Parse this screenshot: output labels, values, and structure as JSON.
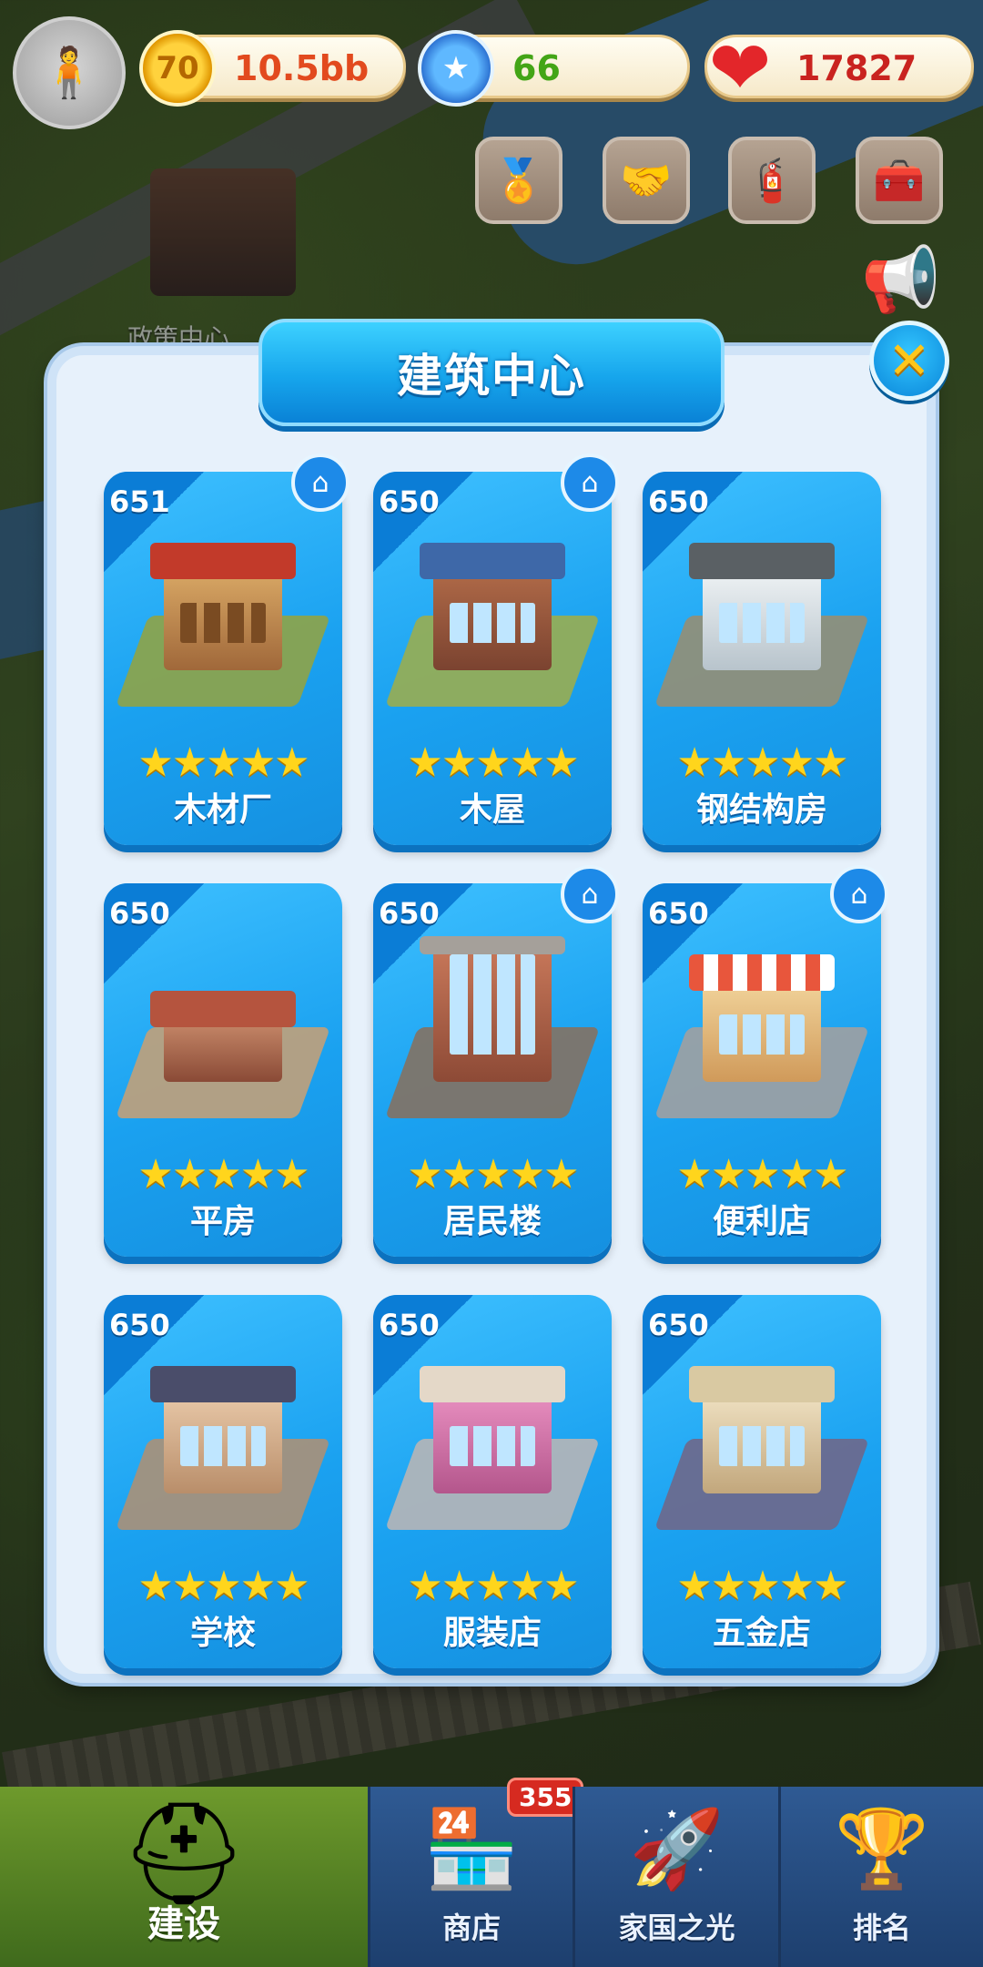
{
  "hud": {
    "coins": "10.5bb",
    "stars": "66",
    "hearts": "17827",
    "coin_icon_text": "70",
    "coin_icon": "coin-icon",
    "star_icon": "star-icon",
    "heart_icon": "heart-icon"
  },
  "background": {
    "building_label": "政策中心"
  },
  "dialog": {
    "title": "建筑中心",
    "close_icon": "close-icon"
  },
  "buildings": [
    {
      "level": "651",
      "name": "木材厂",
      "stars": 5,
      "has_home": true
    },
    {
      "level": "650",
      "name": "木屋",
      "stars": 5,
      "has_home": true
    },
    {
      "level": "650",
      "name": "钢结构房",
      "stars": 5,
      "has_home": false
    },
    {
      "level": "650",
      "name": "平房",
      "stars": 5,
      "has_home": false
    },
    {
      "level": "650",
      "name": "居民楼",
      "stars": 5,
      "has_home": true
    },
    {
      "level": "650",
      "name": "便利店",
      "stars": 5,
      "has_home": true
    },
    {
      "level": "650",
      "name": "学校",
      "stars": 5,
      "has_home": false
    },
    {
      "level": "650",
      "name": "服装店",
      "stars": 5,
      "has_home": false
    },
    {
      "level": "650",
      "name": "五金店",
      "stars": 5,
      "has_home": false
    }
  ],
  "stars_text": "★★★★★",
  "nav": [
    {
      "label": "建设",
      "icon": "helmet-icon",
      "active": true
    },
    {
      "label": "商店",
      "icon": "shop-icon",
      "badge": "355"
    },
    {
      "label": "家国之光",
      "icon": "rocket-icon"
    },
    {
      "label": "排名",
      "icon": "ranking-icon"
    }
  ],
  "colors": {
    "card_blue": "#1aa1f0",
    "panel_bg": "#e7f1fb",
    "coin_text": "#e24a1e",
    "star_text": "#43a516",
    "heart_text": "#c9231f",
    "nav_active": "#6e9a2c"
  }
}
